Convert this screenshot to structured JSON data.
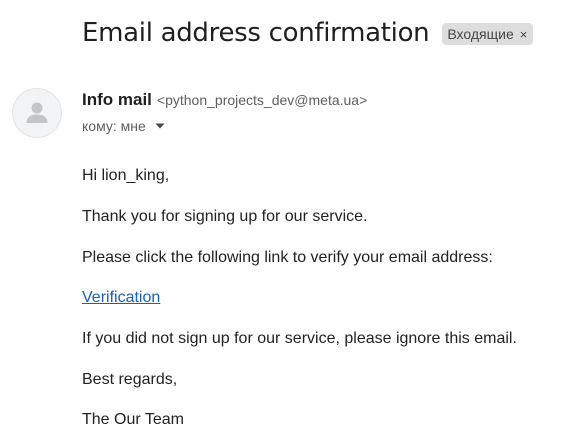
{
  "email": {
    "subject": "Email address confirmation",
    "label": "Входящие",
    "label_remove_glyph": "×",
    "sender": {
      "name": "Info mail",
      "address": "<python_projects_dev@meta.ua>",
      "avatar_icon": "person-icon"
    },
    "recipient_text": "кому: мне",
    "recipient_dropdown_icon": "caret-down-icon",
    "body": {
      "greeting": "Hi lion_king,",
      "thanks": "Thank you for signing up for our service.",
      "instruction": "Please click the following link to verify your email address:",
      "link_text": "Verification",
      "ignore_notice": "If you did not sign up for our service, please ignore this email.",
      "closing": "Best regards,",
      "signature": "The Our Team"
    }
  },
  "colors": {
    "link": "#1a5fb4",
    "label_chip_bg": "#dddddd",
    "avatar_bg": "#f1f3f4",
    "secondary_text": "#5e5e5e"
  }
}
